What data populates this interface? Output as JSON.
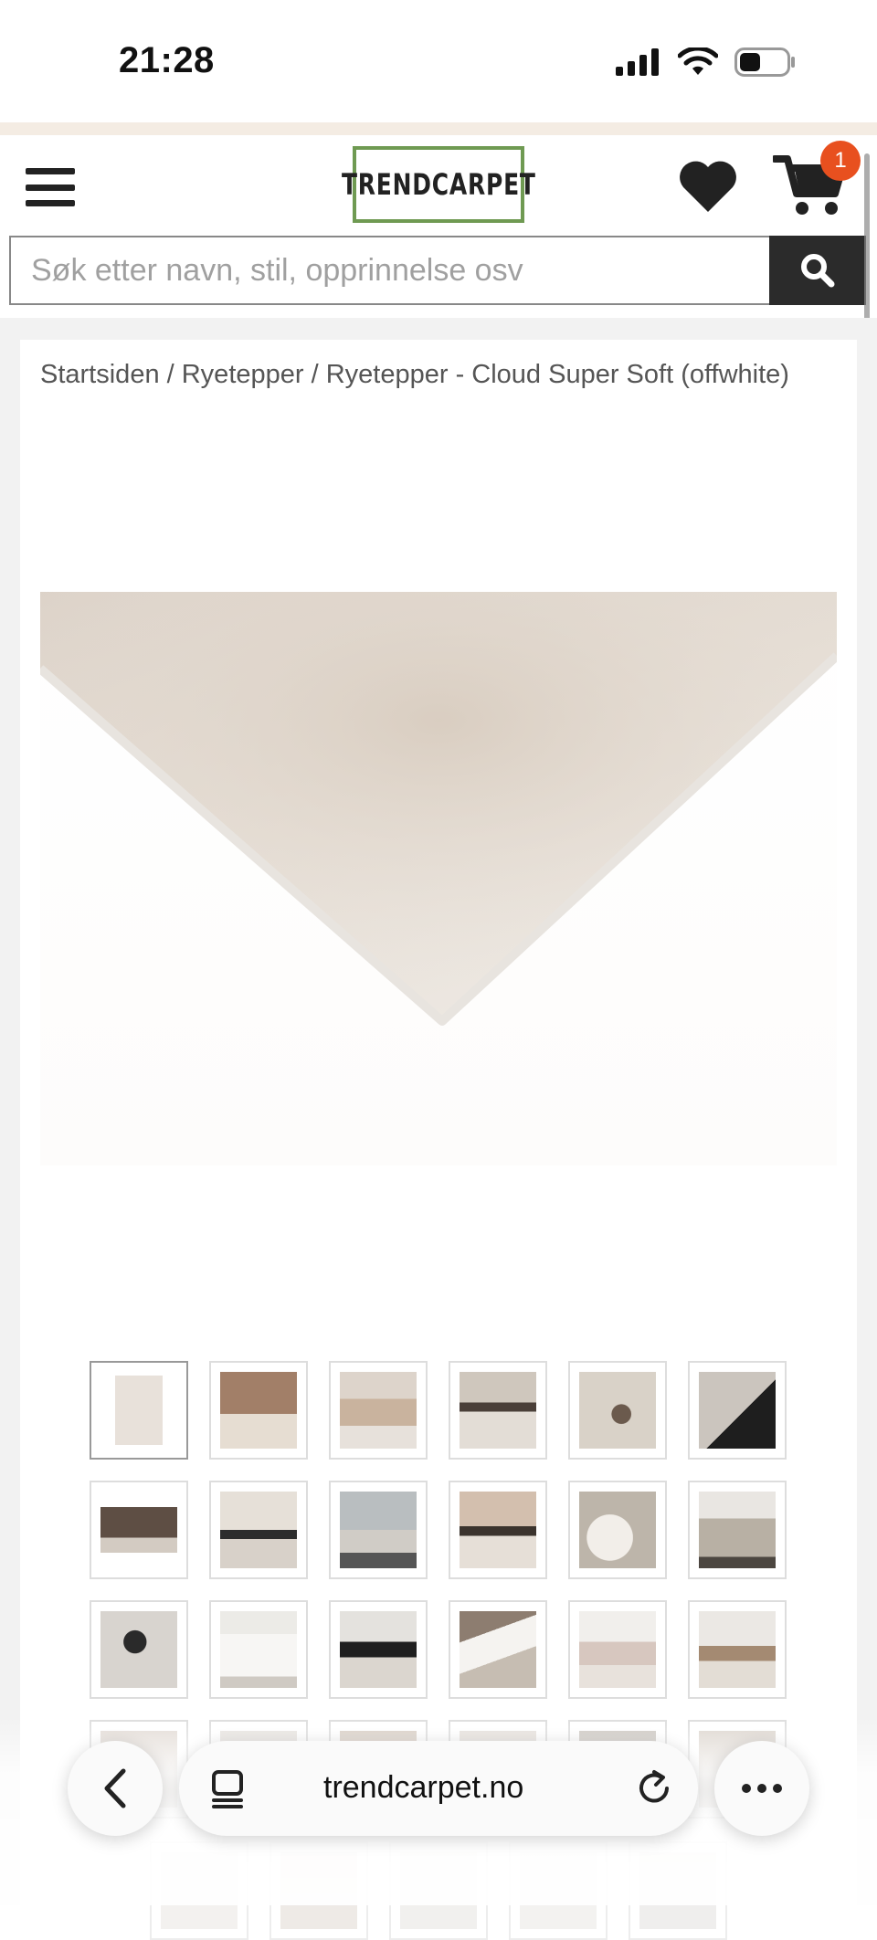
{
  "status_bar": {
    "time": "21:28",
    "icons": [
      "signal-icon",
      "wifi-icon",
      "battery-icon"
    ]
  },
  "header": {
    "logo_text": "TRENDCARPET",
    "cart_count": "1",
    "icons": [
      "menu-icon",
      "heart-icon",
      "cart-icon"
    ],
    "colors": {
      "logo_border": "#6f9a52",
      "badge": "#e8501f"
    }
  },
  "search": {
    "placeholder": "Søk etter navn, stil, opprinnelse osv",
    "value": "",
    "button_icon": "search-icon"
  },
  "breadcrumb": {
    "text": "Startsiden / Ryetepper / Ryetepper - Cloud Super Soft (offwhite)"
  },
  "product": {
    "main_image": "offwhite-shag-rug-corner"
  },
  "gallery": {
    "thumbnails": [
      "rug-flat",
      "bedroom",
      "dining-table",
      "living-room-tables",
      "coffee-table-top",
      "phone-hand",
      "brown-sofa",
      "black-coffee-table",
      "bright-room",
      "beige-interior",
      "lounge",
      "bed-rug",
      "glass-table",
      "white-bed",
      "black-sofa",
      "white-table",
      "pastel-living",
      "dining-room",
      "row4-1",
      "row4-2",
      "row4-3",
      "row4-4",
      "row4-5",
      "row4-6"
    ],
    "selected_index": 0
  },
  "browser": {
    "url": "trendcarpet.no",
    "icons": [
      "back-icon",
      "tabs-icon",
      "reload-icon",
      "more-icon"
    ]
  }
}
